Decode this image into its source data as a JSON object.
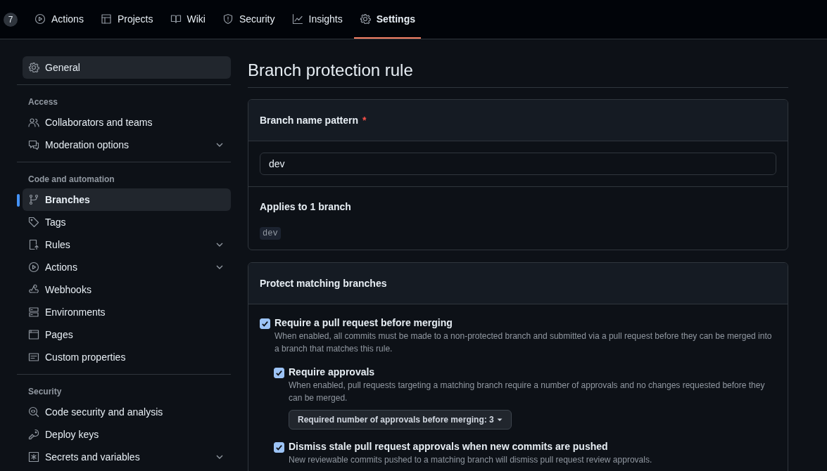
{
  "top_nav": {
    "counter": "7",
    "tabs": [
      {
        "label": "Actions",
        "selected": false
      },
      {
        "label": "Projects",
        "selected": false
      },
      {
        "label": "Wiki",
        "selected": false
      },
      {
        "label": "Security",
        "selected": false
      },
      {
        "label": "Insights",
        "selected": false
      },
      {
        "label": "Settings",
        "selected": true
      }
    ]
  },
  "sidebar": {
    "groups": [
      {
        "items": [
          {
            "label": "General",
            "selected": false,
            "hovered": true,
            "expandable": false
          }
        ]
      },
      {
        "heading": "Access",
        "items": [
          {
            "label": "Collaborators and teams",
            "selected": false,
            "hovered": false,
            "expandable": false
          },
          {
            "label": "Moderation options",
            "selected": false,
            "hovered": false,
            "expandable": true
          }
        ]
      },
      {
        "heading": "Code and automation",
        "items": [
          {
            "label": "Branches",
            "selected": true,
            "hovered": false,
            "expandable": false
          },
          {
            "label": "Tags",
            "selected": false,
            "hovered": false,
            "expandable": false
          },
          {
            "label": "Rules",
            "selected": false,
            "hovered": false,
            "expandable": true
          },
          {
            "label": "Actions",
            "selected": false,
            "hovered": false,
            "expandable": true
          },
          {
            "label": "Webhooks",
            "selected": false,
            "hovered": false,
            "expandable": false
          },
          {
            "label": "Environments",
            "selected": false,
            "hovered": false,
            "expandable": false
          },
          {
            "label": "Pages",
            "selected": false,
            "hovered": false,
            "expandable": false
          },
          {
            "label": "Custom properties",
            "selected": false,
            "hovered": false,
            "expandable": false
          }
        ]
      },
      {
        "heading": "Security",
        "items": [
          {
            "label": "Code security and analysis",
            "selected": false,
            "hovered": false,
            "expandable": false
          },
          {
            "label": "Deploy keys",
            "selected": false,
            "hovered": false,
            "expandable": false
          },
          {
            "label": "Secrets and variables",
            "selected": false,
            "hovered": false,
            "expandable": true
          }
        ]
      }
    ]
  },
  "main": {
    "title": "Branch protection rule",
    "pattern_card": {
      "label": "Branch name pattern",
      "required_mark": "*",
      "value": "dev",
      "applies_label": "Applies to 1 branch",
      "branches": [
        "dev"
      ]
    },
    "protect_card": {
      "title": "Protect matching branches",
      "options": [
        {
          "label": "Require a pull request before merging",
          "checked": true,
          "description": "When enabled, all commits must be made to a non-protected branch and submitted via a pull request before they can be merged into a branch that matches this rule.",
          "children": [
            {
              "label": "Require approvals",
              "checked": true,
              "description": "When enabled, pull requests targeting a matching branch require a number of approvals and no changes requested before they can be merged.",
              "dropdown": "Required number of approvals before merging: 3"
            },
            {
              "label": "Dismiss stale pull request approvals when new commits are pushed",
              "checked": true,
              "description": "New reviewable commits pushed to a matching branch will dismiss pull request review approvals."
            }
          ]
        }
      ]
    }
  }
}
